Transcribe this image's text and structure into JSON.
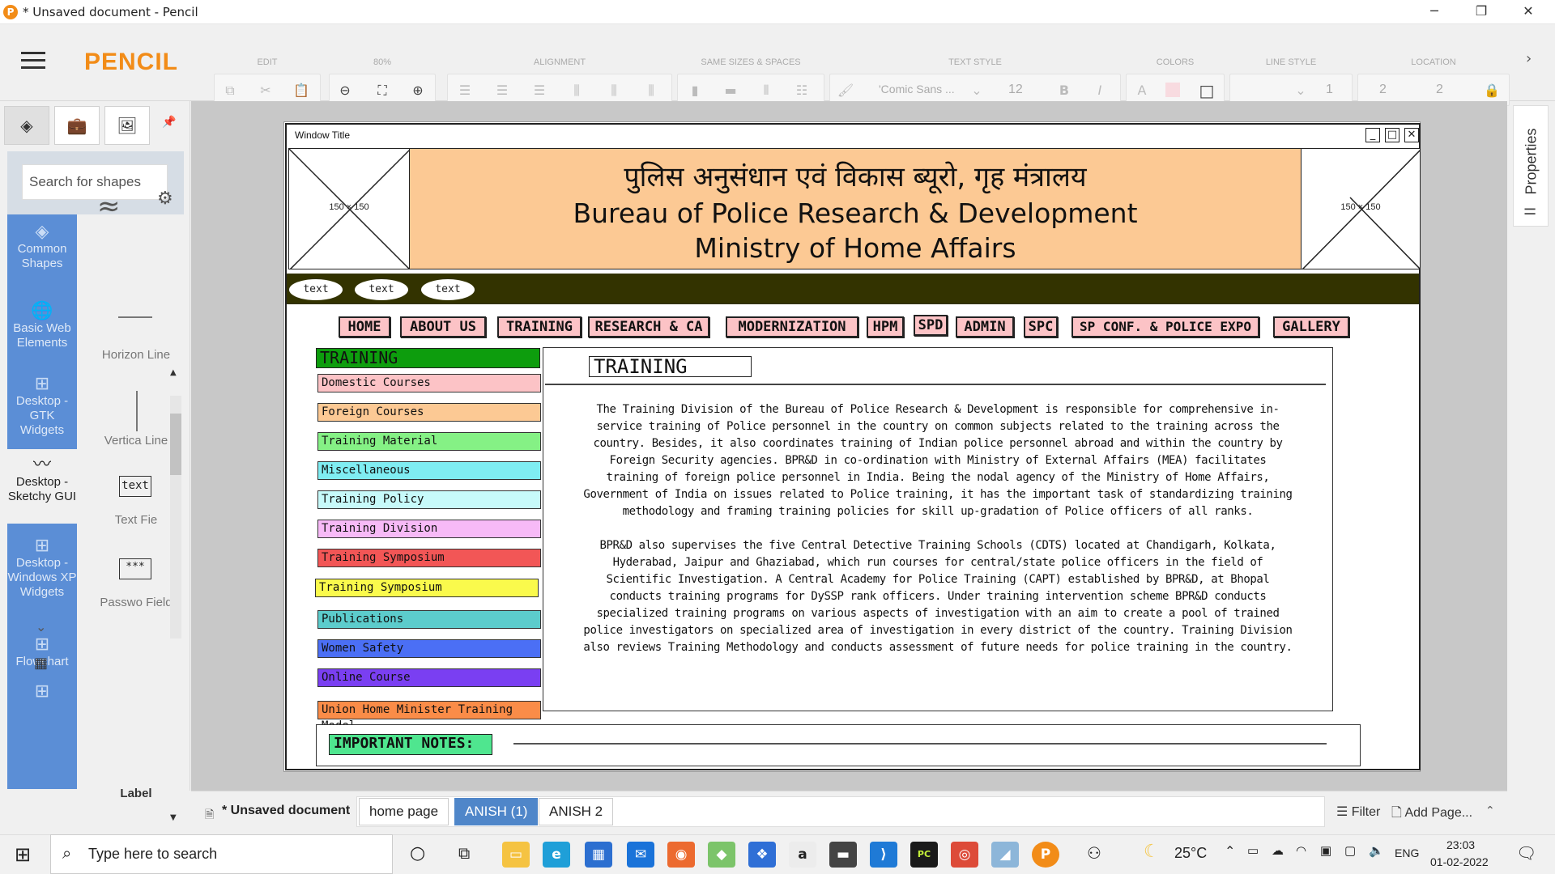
{
  "window": {
    "title": "* Unsaved document - Pencil",
    "controls": {
      "minimize": "─",
      "maximize": "❐",
      "close": "✕"
    }
  },
  "toolbar": {
    "brand": "PENCIL",
    "groups": {
      "edit": "EDIT",
      "zoom": "80%",
      "alignment": "ALIGNMENT",
      "sizes": "SAME SIZES & SPACES",
      "text_style": "TEXT STYLE",
      "colors": "COLORS",
      "line_style": "LINE STYLE",
      "location": "LOCATION"
    },
    "font_name": "'Comic Sans ...",
    "font_size": "12",
    "line_width": "1",
    "loc_x": "2",
    "loc_y": "2"
  },
  "sidebar": {
    "search_placeholder": "Search for shapes",
    "categories": [
      {
        "label": "Common Shapes"
      },
      {
        "label": "Basic Web Elements"
      },
      {
        "label": "Desktop - GTK Widgets"
      },
      {
        "label": "Desktop - Sketchy GUI"
      },
      {
        "label": "Desktop - Windows XP Widgets"
      },
      {
        "label": "Flowchart"
      }
    ],
    "shapes": [
      {
        "label": "Horizon Line"
      },
      {
        "label": "Vertica Line"
      },
      {
        "label": "Text Fie",
        "preview": "text"
      },
      {
        "label": "Passwo Field",
        "preview": "***"
      },
      {
        "label": "Label"
      }
    ]
  },
  "mockup": {
    "window_title": "Window Title",
    "placeholder_left": "150 × 150",
    "placeholder_right": "150 × 150",
    "header": {
      "hindi": "पुलिस अनुसंधान एवं विकास ब्यूरो, गृह मंत्रालय",
      "line1": "Bureau of Police Research & Development",
      "line2": "Ministry of Home Affairs"
    },
    "pills": [
      "text",
      "text",
      "text"
    ],
    "nav": [
      "HOME",
      "ABOUT US",
      "TRAINING",
      "RESEARCH & CA",
      "MODERNIZATION",
      "HPM",
      "SPD",
      "ADMIN",
      "SPC",
      "SP CONF. & POLICE EXPO",
      "GALLERY"
    ],
    "side_title": "TRAINING",
    "side_items": [
      {
        "label": "Domestic Courses",
        "color": "#fcc3c6"
      },
      {
        "label": "Foreign Courses",
        "color": "#fcc994"
      },
      {
        "label": "Training Material",
        "color": "#85f185"
      },
      {
        "label": "Miscellaneous",
        "color": "#7fedf2"
      },
      {
        "label": "Training Policy",
        "color": "#c7fafa"
      },
      {
        "label": "Training Division",
        "color": "#f7baf7"
      },
      {
        "label": "Training Symposium",
        "color": "#f25656"
      },
      {
        "label": "Training Symposium",
        "color": "#fafa4c"
      },
      {
        "label": "Publications",
        "color": "#5ccccc"
      },
      {
        "label": "Women Safety",
        "color": "#4b6ff5"
      },
      {
        "label": "Online Course",
        "color": "#7a3ff2"
      },
      {
        "label": "Union Home Minister Training Model",
        "color": "#fa8c48"
      }
    ],
    "content": {
      "heading": "TRAINING",
      "para1": "The Training Division of the Bureau of Police Research & Development is responsible for comprehensive in-service training of Police personnel in the country on common subjects related to the training across the country. Besides, it also coordinates training of Indian police personnel abroad and within the country by Foreign Security agencies. BPR&D in co-ordination with Ministry of External Affairs (MEA) facilitates training of foreign police personnel in India. Being the nodal agency of the Ministry of Home Affairs, Government of India on issues related to Police training, it has the important task of standardizing training methodology and framing training policies for skill up-gradation of Police officers of all ranks.",
      "para2": "BPR&D also supervises the five Central Detective Training Schools (CDTS) located at Chandigarh, Kolkata, Hyderabad, Jaipur and Ghaziabad, which run courses for central/state police officers in the field of Scientific Investigation. A Central Academy for Police Training (CAPT) established by BPR&D, at Bhopal conducts training programs for DySSP rank officers. Under training intervention scheme BPR&D conducts specialized training programs on various aspects of investigation with an aim to create a pool of trained police investigators on specialized area of investigation in every district of the country. Training Division also reviews Training Methodology and conducts assessment of future needs for police training in the country."
    },
    "notes_label": "IMPORTANT NOTES:"
  },
  "pages": {
    "document": "* Unsaved document",
    "tabs": [
      {
        "label": "home page",
        "active": false
      },
      {
        "label": "ANISH (1)",
        "active": true
      },
      {
        "label": "ANISH 2",
        "active": false
      }
    ],
    "filter": "Filter",
    "add_page": "Add Page..."
  },
  "properties_tab": "Properties",
  "taskbar": {
    "search_placeholder": "Type here to search",
    "temperature": "25°C",
    "language": "ENG",
    "time": "23:03",
    "date": "01-02-2022"
  },
  "colors": {
    "brand": "#f28c18",
    "header_bg": "#fcc994",
    "nav_bg": "#fcc3c6",
    "side_title_bg": "#0d9d0d",
    "notes_bg": "#4fe68f",
    "category_bg": "#5b8ed6",
    "active_tab": "#4f86c9"
  }
}
